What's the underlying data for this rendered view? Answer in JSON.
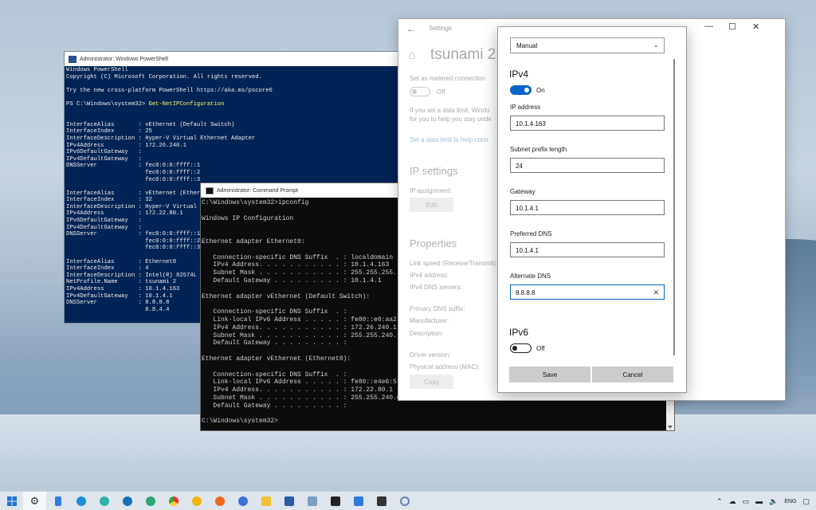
{
  "powershell": {
    "title": "Administrator: Windows PowerShell",
    "lines": [
      "Windows PowerShell",
      "Copyright (C) Microsoft Corporation. All rights reserved.",
      "",
      "Try the new cross-platform PowerShell https://aka.ms/pscore6",
      "",
      "PS C:\\Windows\\system32> ",
      "",
      "",
      "InterfaceAlias       : vEthernet (Default Switch)",
      "InterfaceIndex       : 25",
      "InterfaceDescription : Hyper-V Virtual Ethernet Adapter",
      "IPv4Address          : 172.26.240.1",
      "IPv6DefaultGateway   :",
      "IPv4DefaultGateway   :",
      "DNSServer            : fec0:0:0:ffff::1",
      "                       fec0:0:0:ffff::2",
      "                       fec0:0:0:ffff::3",
      "",
      "InterfaceAlias       : vEthernet (Ethern",
      "InterfaceIndex       : 32",
      "InterfaceDescription : Hyper-V Virtual E",
      "IPv4Address          : 172.22.80.1",
      "IPv6DefaultGateway   :",
      "IPv4DefaultGateway   :",
      "DNSServer            : fec0:0:0:ffff::1",
      "                       fec0:0:0:ffff::2",
      "                       fec0:0:0:ffff::3",
      "",
      "InterfaceAlias       : Ethernet0",
      "InterfaceIndex       : 4",
      "InterfaceDescription : Intel(R) 82574L G",
      "NetProfile.Name      : tsunami 2",
      "IPv4Address          : 10.1.4.163",
      "IPv4DefaultGateway   : 10.1.4.1",
      "DNSServer            : 8.8.8.8",
      "                       8.8.4.4"
    ],
    "command": "Get-NetIPConfiguration"
  },
  "cmd": {
    "title": "Administrator: Command Prompt",
    "text": "C:\\Windows\\system32>ipconfig\n\nWindows IP Configuration\n\n\nEthernet adapter Ethernet0:\n\n   Connection-specific DNS Suffix  . : localdomain\n   IPv4 Address. . . . . . . . . . . : 10.1.4.163\n   Subnet Mask . . . . . . . . . . . : 255.255.255.\n   Default Gateway . . . . . . . . . : 10.1.4.1\n\nEthernet adapter vEthernet (Default Switch):\n\n   Connection-specific DNS Suffix  . :\n   Link-local IPv6 Address . . . . . : fe80::e0:aa2\n   IPv4 Address. . . . . . . . . . . : 172.26.240.1\n   Subnet Mask . . . . . . . . . . . : 255.255.240.\n   Default Gateway . . . . . . . . . :\n\nEthernet adapter vEthernet (Ethernet0):\n\n   Connection-specific DNS Suffix  . :\n   Link-local IPv6 Address . . . . . : fe80::e4e6:5\n   IPv4 Address. . . . . . . . . . . : 172.22.80.1\n   Subnet Mask . . . . . . . . . . . : 255.255.240.0\n   Default Gateway . . . . . . . . . :\n\nC:\\Windows\\system32>"
  },
  "settings": {
    "app_title": "Settings",
    "network_name": "tsunami 2",
    "metered_label": "Set as metered connection",
    "metered_state": "Off",
    "data_limit_text_1": "If you set a data limit, Windo",
    "data_limit_text_2": "for you to help you stay unde",
    "data_limit_link": "Set a data limit to help contr",
    "ip_settings_heading": "IP settings",
    "ip_assignment_label": "IP assignment:",
    "edit_button": "Edit",
    "properties_heading": "Properties",
    "link_speed_label": "Link speed (Receive/Transmit)",
    "ipv4_address_label": "IPv4 address:",
    "ipv4_dns_label": "IPv4 DNS servers:",
    "primary_dns_suffix_label": "Primary DNS suffix:",
    "manufacturer_label": "Manufacturer:",
    "description_label": "Description:",
    "driver_version_label": "Driver version:",
    "physical_address_label": "Physical address (MAC):",
    "copy_button": "Copy",
    "minimize": "—",
    "maximize": "☐",
    "close": "✕"
  },
  "dialog": {
    "mode_select": "Manual",
    "ipv4_heading": "IPv4",
    "ipv4_toggle_state": "On",
    "ip_address_label": "IP address",
    "ip_address_value": "10.1.4.163",
    "subnet_label": "Subnet prefix length",
    "subnet_value": "24",
    "gateway_label": "Gateway",
    "gateway_value": "10.1.4.1",
    "preferred_dns_label": "Preferred DNS",
    "preferred_dns_value": "10.1.4.1",
    "alternate_dns_label": "Alternate DNS",
    "alternate_dns_value": "8.8.8.8",
    "ipv6_heading": "IPv6",
    "ipv6_toggle_state": "Off",
    "save_button": "Save",
    "cancel_button": "Cancel"
  },
  "taskbar": {
    "icons": [
      "start-icon",
      "settings-icon",
      "file-icon",
      "edge-icon",
      "edge-beta-icon",
      "edge-dev-icon",
      "edge-canary-icon",
      "chrome-icon",
      "chrome-canary-icon",
      "firefox-icon",
      "firefox-dev-icon",
      "file-explorer-icon",
      "powershell-icon",
      "cmd-icon",
      "terminal-icon",
      "photos-icon",
      "wsl-icon",
      "network-icon"
    ],
    "language": "ENG",
    "colors": {
      "accent": "#0a64c8",
      "ps_bg": "#012456",
      "cmd_bg": "#0c0c0c"
    }
  }
}
